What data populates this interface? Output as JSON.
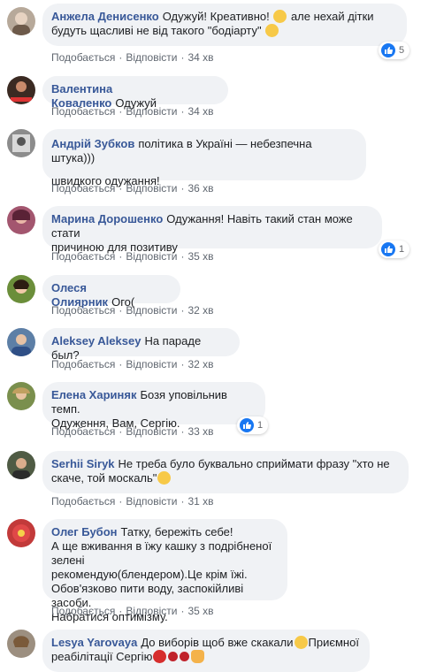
{
  "actions": {
    "like": "Подобається",
    "reply": "Відповісти",
    "sep": "·"
  },
  "comments": [
    {
      "author": "Анжела Денисенко",
      "lines": [
        "Одужуй! Креативно! ",
        "будуть щасливі не від такого \"бодіарту\" "
      ],
      "line1_tail": "але нехай дітки",
      "time": "34 хв",
      "reactions": "5",
      "avatar_color": "#b7a99a"
    },
    {
      "author": "Валентина Коваленко",
      "lines": [
        "Одужуй"
      ],
      "time": "34 хв",
      "avatar_color": "#3b2a22"
    },
    {
      "author": "Андрій Зубков",
      "lines": [
        "політика в Україні — небезпечна штука)))",
        "швидкого одужання!"
      ],
      "time": "36 хв",
      "avatar_color": "#8c8c8c"
    },
    {
      "author": "Марина Дорошенко",
      "lines": [
        "Одужання! Навіть такий стан може стати",
        "причиною для позитиву"
      ],
      "time": "35 хв",
      "reactions": "1",
      "avatar_color": "#a3566f"
    },
    {
      "author": "Олеся Олиярник",
      "lines": [
        "Ого("
      ],
      "time": "32 хв",
      "avatar_color": "#6b8e3a"
    },
    {
      "author": "Aleksey Aleksey",
      "lines": [
        "На параде был?"
      ],
      "time": "32 хв",
      "avatar_color": "#5d7fa6"
    },
    {
      "author": "Елена Хариняк",
      "lines": [
        "Бозя уповільнив темп.",
        "Одуження, Вам, Сергію."
      ],
      "time": "33 хв",
      "reactions": "1",
      "avatar_color": "#7a8f4d"
    },
    {
      "author": "Serhii Siryk",
      "lines": [
        "Не треба було буквально сприймати фразу \"хто не",
        "скаче, той москаль\""
      ],
      "time": "31 хв",
      "avatar_color": "#4f5b44"
    },
    {
      "author": "Олег Бубон",
      "lines": [
        "Татку, бережіть себе!",
        "А ще вживання в їжу кашку з подрібненої зелені",
        "рекомендую(блендером).Це крім їжі.",
        "Обов'язково пити воду, заспокійливі засоби.",
        "Набратися оптимізму."
      ],
      "time": "35 хв",
      "avatar_color": "#c23a3a"
    },
    {
      "author": "Lesya Yarovaya",
      "lines": [
        "До виборів щоб вже скакали",
        "реабілітації Сергію"
      ],
      "line1_tail": "Приємної",
      "avatar_color": "#9c8f80"
    }
  ]
}
